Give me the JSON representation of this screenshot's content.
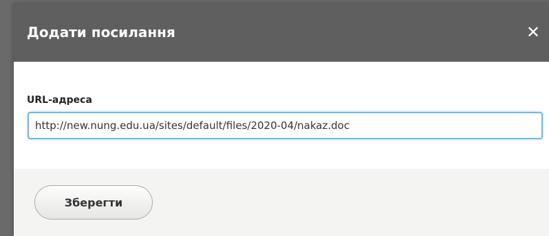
{
  "dialog": {
    "title": "Додати посилання",
    "close_glyph": "✕",
    "close_icon": "close-icon"
  },
  "form": {
    "url_label": "URL-адреса",
    "url_value": "http://new.nung.edu.ua/sites/default/files/2020-04/nakaz.doc"
  },
  "footer": {
    "save_label": "Зберегти"
  },
  "colors": {
    "titlebar": "#5f5f5f",
    "input_focus_border": "#6cb8f0",
    "footer_bg": "#f4f4f2"
  }
}
